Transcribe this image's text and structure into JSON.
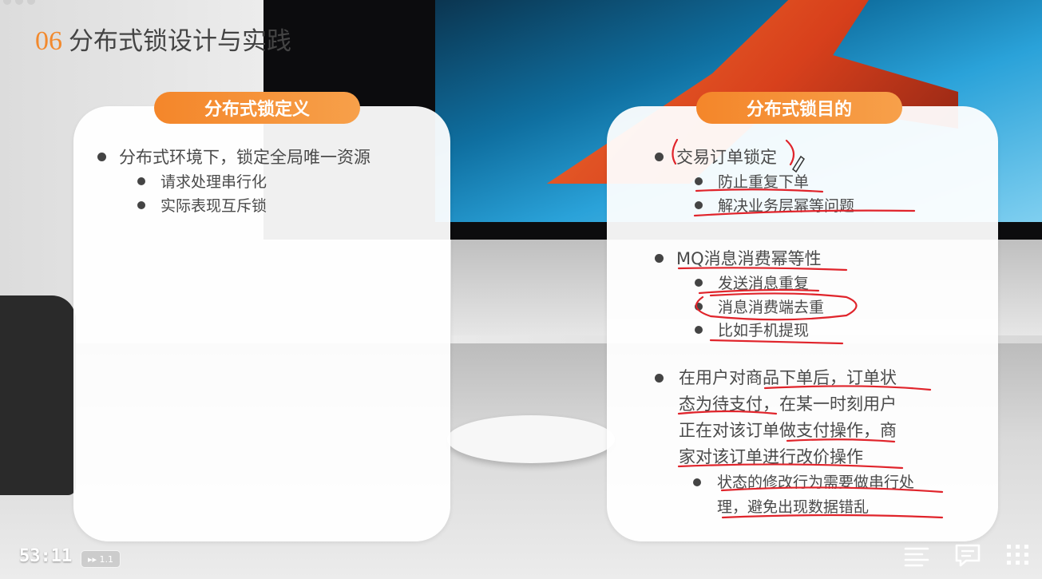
{
  "slide": {
    "number": "06",
    "title": "分布式锁设计与实践"
  },
  "left_card": {
    "heading": "分布式锁定义",
    "bullet": "分布式环境下，锁定全局唯一资源",
    "sub_bullets": [
      "请求处理串行化",
      "实际表现互斥锁"
    ]
  },
  "right_card": {
    "heading": "分布式锁目的",
    "groups": [
      {
        "bullet": "交易订单锁定",
        "sub_bullets": [
          "防止重复下单",
          "解决业务层幂等问题"
        ]
      },
      {
        "bullet": "MQ消息消费幂等性",
        "sub_bullets": [
          "发送消息重复",
          "消息消费端去重",
          "比如手机提现"
        ]
      }
    ],
    "paragraph_lines": [
      "在用户对商品下单后，订单状",
      "态为待支付，在某一时刻用户",
      "正在对该订单做支付操作，商",
      "家对该订单进行改价操作"
    ],
    "paragraph_sub_lines": [
      "状态的修改行为需要做串行处",
      "理，避免出现数据错乱"
    ]
  },
  "player": {
    "time": "53:11",
    "speed": "1.1",
    "icons": [
      "playlist-icon",
      "comment-icon",
      "grid-menu-icon"
    ]
  },
  "colors": {
    "accent": "#f2892d",
    "annotation": "#e0242b"
  }
}
